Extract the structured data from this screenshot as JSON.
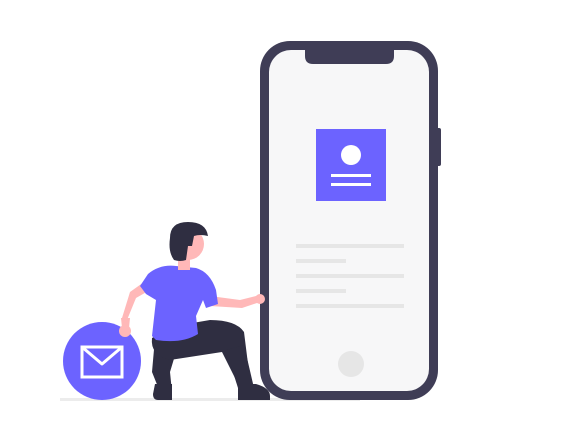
{
  "illustration": {
    "subject": "woman-kneeling-beside-smartphone-with-mail-icon",
    "icons": [
      "profile-card-icon",
      "mail-icon"
    ],
    "colors": {
      "accent": "#6C63FF",
      "phone_frame": "#3F3D56",
      "screen": "#F7F7F8",
      "placeholder_lines": "#E6E6E6",
      "skin": "#FFB8B8",
      "hair": "#2F2E41",
      "pants": "#2F2E41",
      "ground": "#E6E6E6"
    }
  }
}
